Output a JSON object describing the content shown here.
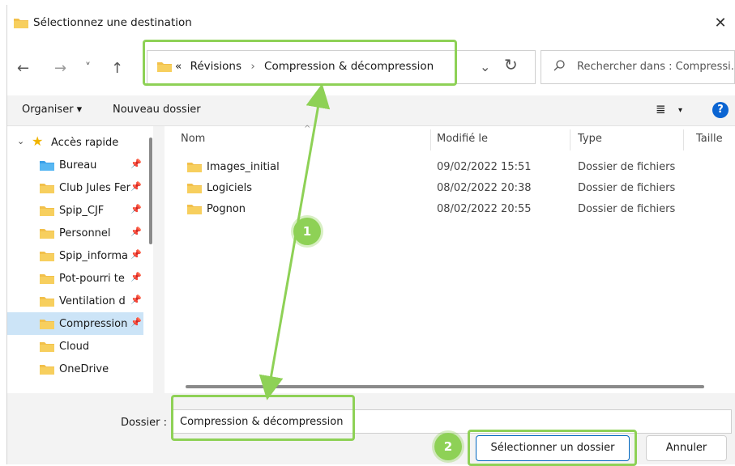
{
  "window": {
    "title": "Sélectionnez une destination"
  },
  "nav": {
    "back_icon": "←",
    "forward_icon": "→",
    "recent_icon": "˅",
    "up_icon": "↑",
    "breadcrumb_overflow": "«",
    "breadcrumb": [
      "Révisions",
      "Compression & décompression"
    ],
    "breadcrumb_sep": "›",
    "search_placeholder": "Rechercher dans : Compressi..."
  },
  "toolbar": {
    "organize": "Organiser ▾",
    "new_folder": "Nouveau dossier",
    "view_icon": "≣",
    "view_caret": "▾",
    "help": "?"
  },
  "sidebar": {
    "quick_access": "Accès rapide",
    "items": [
      {
        "label": "Bureau",
        "icon": "desktop-folder-icon",
        "pinned": true,
        "selected": false
      },
      {
        "label": "Club Jules Fer",
        "icon": "folder-icon",
        "pinned": true,
        "selected": false
      },
      {
        "label": "Spip_CJF",
        "icon": "folder-icon",
        "pinned": true,
        "selected": false
      },
      {
        "label": "Personnel",
        "icon": "folder-icon",
        "pinned": true,
        "selected": false
      },
      {
        "label": "Spip_informa",
        "icon": "folder-icon",
        "pinned": true,
        "selected": false
      },
      {
        "label": "Pot-pourri te",
        "icon": "folder-icon",
        "pinned": true,
        "selected": false
      },
      {
        "label": "Ventilation d",
        "icon": "folder-icon",
        "pinned": true,
        "selected": false
      },
      {
        "label": "Compression",
        "icon": "folder-icon",
        "pinned": true,
        "selected": true
      },
      {
        "label": "Cloud",
        "icon": "folder-icon",
        "pinned": false,
        "selected": false
      },
      {
        "label": "OneDrive",
        "icon": "folder-icon",
        "pinned": false,
        "selected": false
      }
    ]
  },
  "filelist": {
    "columns": {
      "name": "Nom",
      "modified": "Modifié le",
      "type": "Type",
      "size": "Taille"
    },
    "rows": [
      {
        "name": "Images_initial",
        "modified": "09/02/2022 15:51",
        "type": "Dossier de fichiers"
      },
      {
        "name": "Logiciels",
        "modified": "08/02/2022 20:38",
        "type": "Dossier de fichiers"
      },
      {
        "name": "Pognon",
        "modified": "08/02/2022 20:55",
        "type": "Dossier de fichiers"
      }
    ]
  },
  "footer": {
    "folder_label": "Dossier :",
    "folder_value": "Compression & décompression",
    "select_button": "Sélectionner un dossier",
    "cancel_button": "Annuler"
  },
  "annotations": {
    "badge1": "1",
    "badge2": "2",
    "color": "#8ed156"
  },
  "colors": {
    "folder": "#f2c04b",
    "selected": "#cce4f7",
    "accent": "#0067c0"
  }
}
